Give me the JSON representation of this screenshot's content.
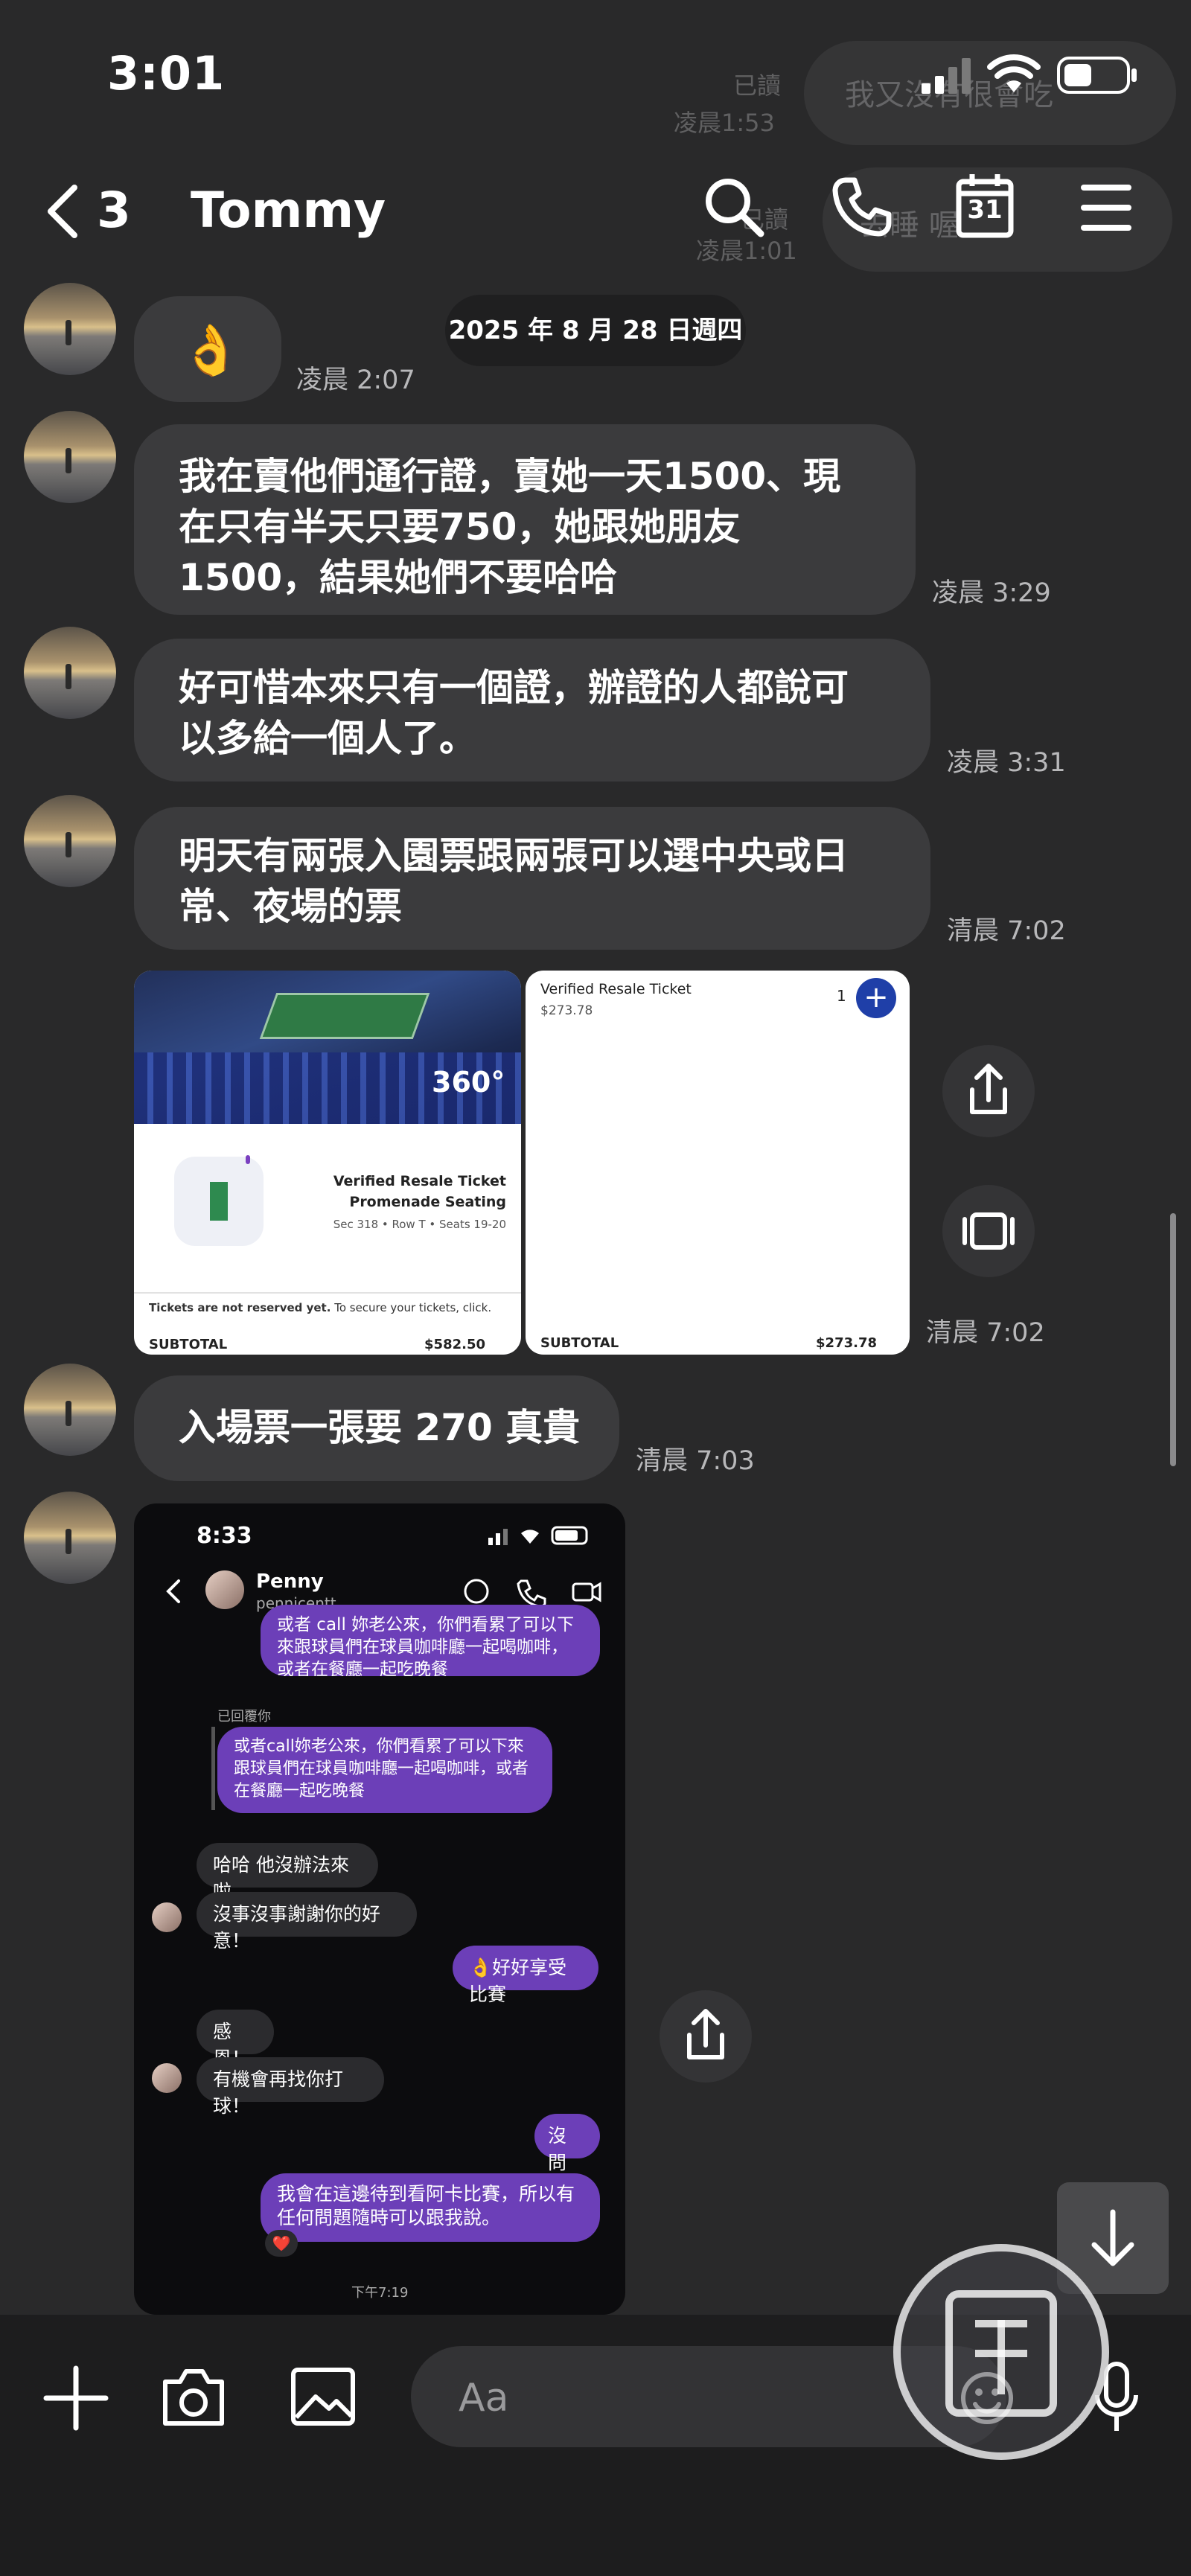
{
  "status_bar": {
    "time": "3:01"
  },
  "header": {
    "back_count": "3",
    "contact_name": "Tommy",
    "calendar_day": "31"
  },
  "background_ghost": {
    "line1": "我又沒有很會吃",
    "line2": "去睡 喔",
    "read1": "已讀",
    "time1": "凌晨1:53",
    "read2": "已讀",
    "time2": "凌晨1:01"
  },
  "messages": {
    "m1": {
      "emoji": "👌",
      "time": "凌晨 2:07"
    },
    "date_divider": "2025 年 8 月 28 日週四",
    "m2": {
      "text": "我在賣他們通行證，賣她一天1500、現\n在只有半天只要750，她跟她朋友\n1500，結果她們不要哈哈",
      "time": "凌晨 3:29"
    },
    "m3": {
      "text": "好可惜本來只有一個證，辦證的人都說可\n以多給一個人了。",
      "time": "凌晨 3:31"
    },
    "m4": {
      "text": "明天有兩張入園票跟兩張可以選中央或日\n常、夜場的票",
      "time": "清晨 7:02"
    },
    "m5": {
      "time": "清晨 7:02"
    },
    "m6": {
      "text": "入場票一張要 270 真貴",
      "time": "清晨 7:03"
    }
  },
  "ticket_left": {
    "badge_360": "360°",
    "title": "Verified Resale Ticket",
    "section": "Promenade Seating",
    "seat_line": "Sec 318 • Row T • Seats 19-20",
    "notice_bold": "Tickets are not reserved yet.",
    "notice_rest": " To secure your tickets, click.",
    "subtotal_label": "SUBTOTAL",
    "subtotal_value": "$582.50"
  },
  "ticket_right": {
    "title": "Verified Resale Ticket",
    "price": "$273.78",
    "qty": "1",
    "subtotal_label": "SUBTOTAL",
    "subtotal_value": "$273.78"
  },
  "embedded_chat": {
    "time": "8:33",
    "name": "Penny",
    "handle": "pennicentt",
    "msg1": "或者 call 妳老公來，你們看累了可以下來跟球員們在球員咖啡廳一起喝咖啡，或者在餐廳一起吃晚餐",
    "replied_label": "已回覆你",
    "msg2": "或者call妳老公來，你們看累了可以下來跟球員們在球員咖啡廳一起喝咖啡，或者在餐廳一起吃晚餐",
    "msg3": "哈哈 他沒辦法來啦",
    "msg4": "沒事沒事謝謝你的好意！",
    "msg5": "👌好好享受比賽",
    "msg6": "感恩！",
    "msg7": "有機會再找你打球！",
    "msg8": "沒問題",
    "msg9": "我會在這邊待到看阿卡比賽，所以有任何問題隨時可以跟我說。",
    "reaction": "❤️",
    "footer_time": "下午7:19"
  },
  "composer": {
    "placeholder": "Aa"
  },
  "colors": {
    "background": "#29292a",
    "bubble": "#3b3b3d",
    "accent_purple": "#6c3fb8",
    "ticket_blue": "#1f3fa8"
  }
}
